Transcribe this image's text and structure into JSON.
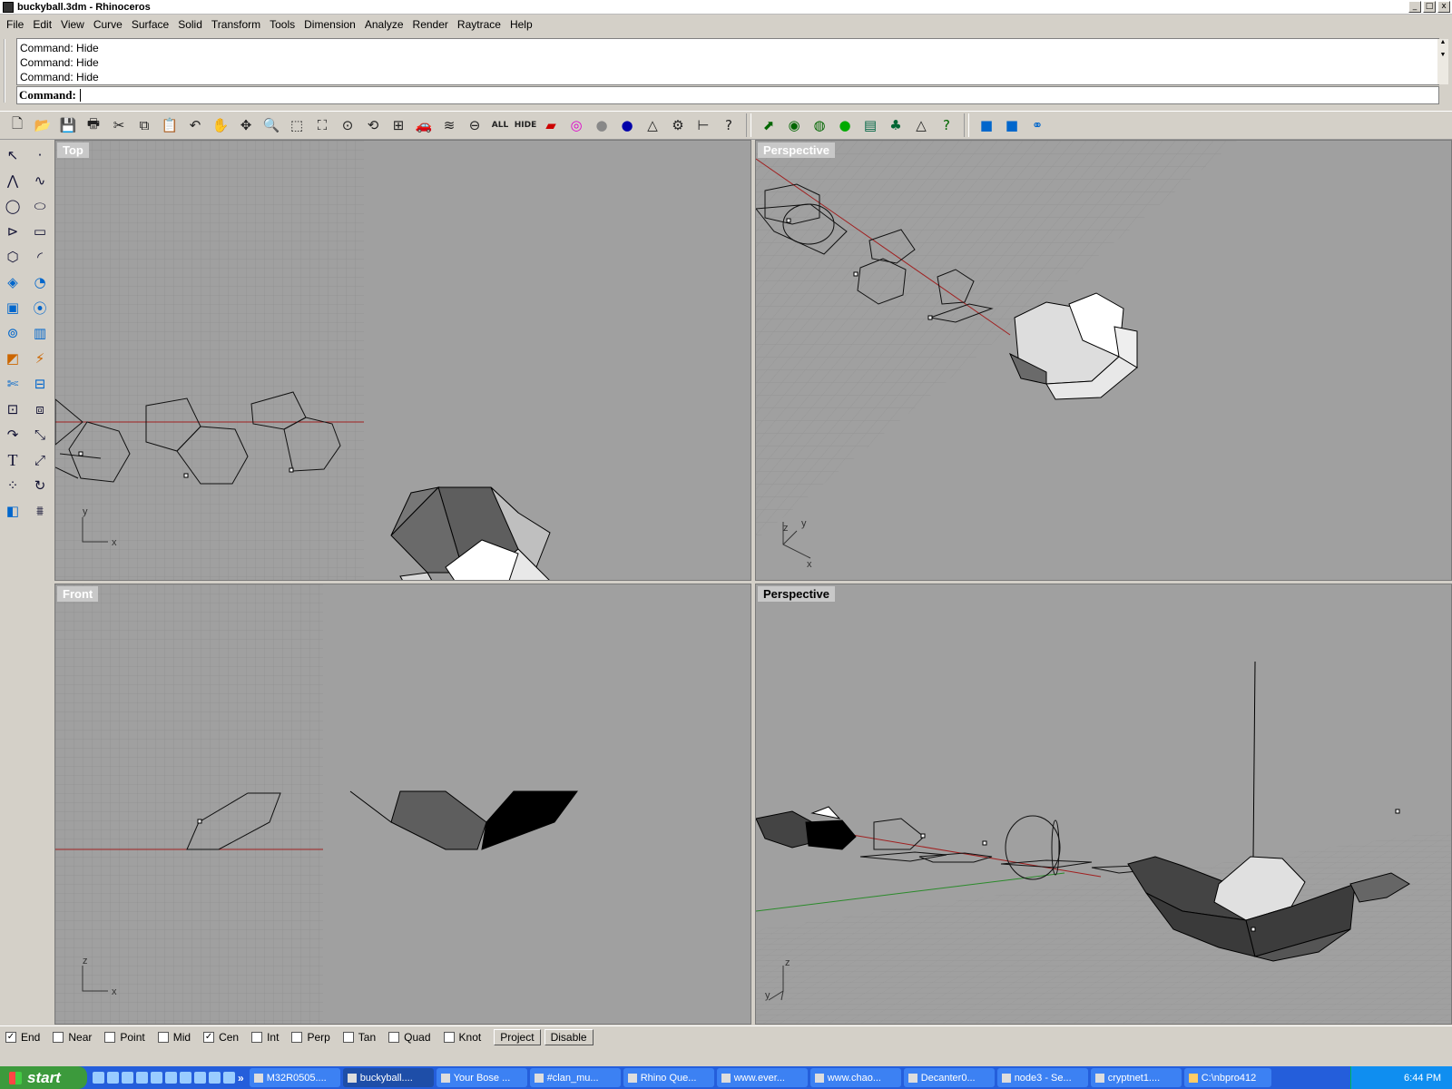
{
  "window": {
    "title": "buckyball.3dm - Rhinoceros",
    "min": "_",
    "max": "□",
    "close": "x"
  },
  "menu": [
    {
      "label": "File"
    },
    {
      "label": "Edit"
    },
    {
      "label": "View"
    },
    {
      "label": "Curve"
    },
    {
      "label": "Surface"
    },
    {
      "label": "Solid"
    },
    {
      "label": "Transform"
    },
    {
      "label": "Tools"
    },
    {
      "label": "Dimension"
    },
    {
      "label": "Analyze"
    },
    {
      "label": "Render"
    },
    {
      "label": "Raytrace"
    },
    {
      "label": "Help"
    }
  ],
  "command": {
    "history": [
      "Command: Hide",
      "Command: Hide",
      "Command: Hide"
    ],
    "prompt": "Command:",
    "value": ""
  },
  "toolbar": {
    "icons": [
      "new-icon",
      "open-icon",
      "save-icon",
      "print-icon",
      "cut-icon",
      "copy-icon",
      "paste-icon",
      "undo-icon",
      "pan-icon",
      "rotate-view-icon",
      "zoom-icon",
      "zoom-window-icon",
      "zoom-extents-icon",
      "zoom-selected-icon",
      "undo-view-icon",
      "four-viewports-icon",
      "car-render-icon",
      "layer-icon",
      "properties-icon"
    ],
    "show_all": "ALL",
    "hide": "HIDE",
    "icons2": [
      "object-properties-icon",
      "color-wheel-icon",
      "sphere-gray-icon",
      "sphere-blue-icon",
      "cone-icon",
      "gear-icon",
      "dimension-icon",
      "help-icon"
    ],
    "render_icons": [
      "render-preview-icon",
      "render-icon",
      "save-render-icon",
      "green-sphere-icon",
      "environment-icon",
      "tree-icon",
      "cone-light-icon",
      "render-help-icon"
    ],
    "cube_icons": [
      "blue-cube-icon",
      "blue-cube-2-icon",
      "blue-link-icon"
    ]
  },
  "left_tools": [
    "select-icon",
    "point-icon",
    "polyline-icon",
    "curve-icon",
    "circle-icon",
    "ellipse-icon",
    "polyline-2-icon",
    "rectangle-icon",
    "polygon-icon",
    "arc-icon",
    "surface-icon",
    "revolve-icon",
    "box-icon",
    "boolean-icon",
    "cylinder-icon",
    "extrude-icon",
    "paint-icon",
    "analyze-icon",
    "trim-icon",
    "split-icon",
    "array-icon",
    "group-icon",
    "fillet-icon",
    "move-icon",
    "text-icon",
    "scale-icon",
    "point-cloud-icon",
    "rotate-icon",
    "layers-icon",
    "grid-icon"
  ],
  "viewports": {
    "top": {
      "label": "Top",
      "axis_y": "y",
      "axis_x": "x"
    },
    "perspective1": {
      "label": "Perspective",
      "axis_z": "z",
      "axis_y": "y",
      "axis_x": "x"
    },
    "front": {
      "label": "Front",
      "axis_z": "z",
      "axis_x": "x"
    },
    "perspective2": {
      "label": "Perspective",
      "axis_z": "z",
      "axis_y": "y"
    }
  },
  "osnap": {
    "items": [
      {
        "label": "End",
        "checked": true
      },
      {
        "label": "Near",
        "checked": false
      },
      {
        "label": "Point",
        "checked": false
      },
      {
        "label": "Mid",
        "checked": false
      },
      {
        "label": "Cen",
        "checked": true
      },
      {
        "label": "Int",
        "checked": false
      },
      {
        "label": "Perp",
        "checked": false
      },
      {
        "label": "Tan",
        "checked": false
      },
      {
        "label": "Quad",
        "checked": false
      },
      {
        "label": "Knot",
        "checked": false
      }
    ],
    "project": "Project",
    "disable": "Disable"
  },
  "taskbar": {
    "start": "start",
    "more": "»",
    "tasks": [
      "M32R0505....",
      "buckyball....",
      "Your Bose ...",
      "#clan_mu...",
      "Rhino Que...",
      "www.ever...",
      "www.chao...",
      "Decanter0...",
      "node3 - Se...",
      "cryptnet1....",
      "C:\\nbpro412"
    ],
    "active_index": 1,
    "clock": "6:44 PM"
  }
}
